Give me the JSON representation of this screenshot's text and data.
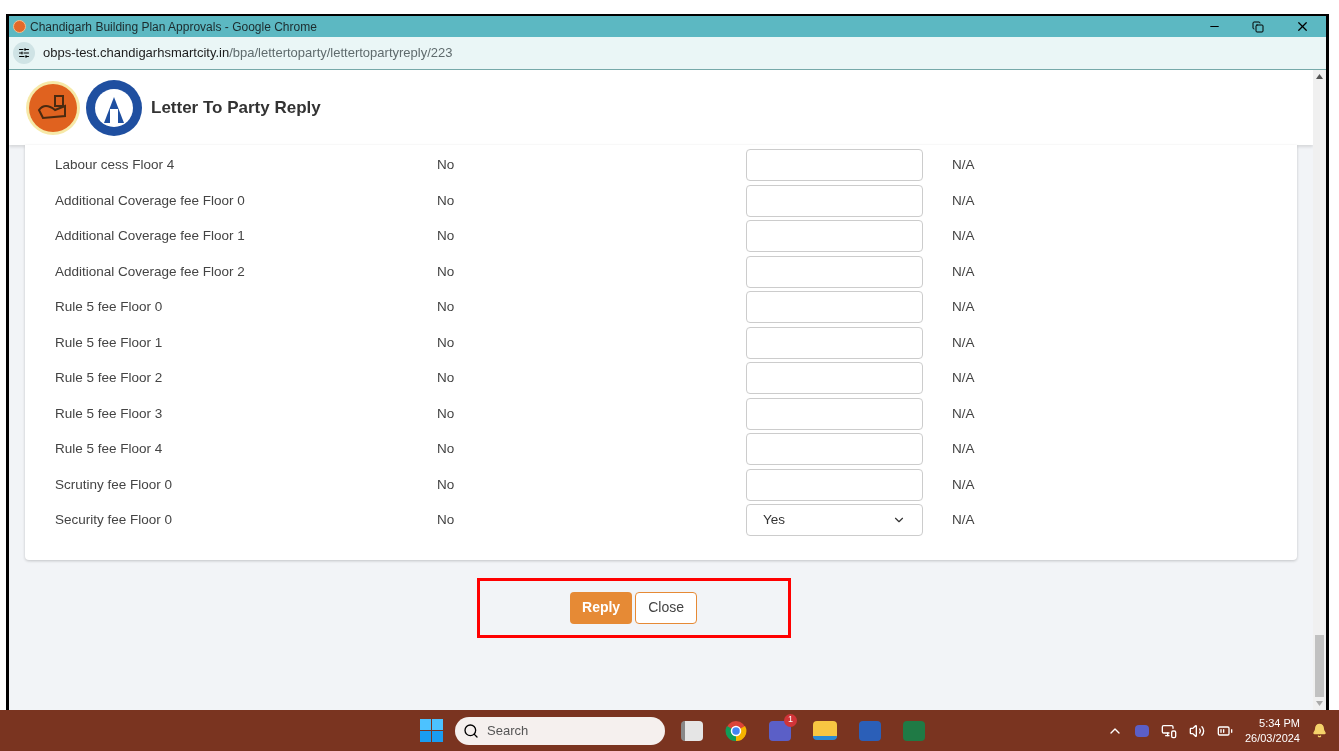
{
  "window": {
    "title": "Chandigarh Building Plan Approvals - Google Chrome"
  },
  "address_bar": {
    "host": "obps-test.chandigarhsmartcity.in",
    "path": "/bpa/lettertoparty/lettertopartyreply/223"
  },
  "header": {
    "title": "Letter To Party Reply"
  },
  "rows": [
    {
      "label": "Labour cess Floor 4",
      "value": "No",
      "field": {
        "kind": "text"
      },
      "status": "N/A"
    },
    {
      "label": "Additional Coverage fee Floor 0",
      "value": "No",
      "field": {
        "kind": "text"
      },
      "status": "N/A"
    },
    {
      "label": "Additional Coverage fee Floor 1",
      "value": "No",
      "field": {
        "kind": "text"
      },
      "status": "N/A"
    },
    {
      "label": "Additional Coverage fee Floor 2",
      "value": "No",
      "field": {
        "kind": "text"
      },
      "status": "N/A"
    },
    {
      "label": "Rule 5 fee Floor 0",
      "value": "No",
      "field": {
        "kind": "text"
      },
      "status": "N/A"
    },
    {
      "label": "Rule 5 fee Floor 1",
      "value": "No",
      "field": {
        "kind": "text"
      },
      "status": "N/A"
    },
    {
      "label": "Rule 5 fee Floor 2",
      "value": "No",
      "field": {
        "kind": "text"
      },
      "status": "N/A"
    },
    {
      "label": "Rule 5 fee Floor 3",
      "value": "No",
      "field": {
        "kind": "text"
      },
      "status": "N/A"
    },
    {
      "label": "Rule 5 fee Floor 4",
      "value": "No",
      "field": {
        "kind": "text"
      },
      "status": "N/A"
    },
    {
      "label": "Scrutiny fee Floor 0",
      "value": "No",
      "field": {
        "kind": "text"
      },
      "status": "N/A"
    },
    {
      "label": "Security fee Floor 0",
      "value": "No",
      "field": {
        "kind": "select",
        "value": "Yes"
      },
      "status": "N/A"
    }
  ],
  "buttons": [
    {
      "label": "Reply",
      "kind": "primary"
    },
    {
      "label": "Close",
      "kind": "outline"
    }
  ],
  "taskbar": {
    "search_placeholder": "Search",
    "teams_badge": "1",
    "time": "5:34 PM",
    "date": "26/03/2024"
  }
}
